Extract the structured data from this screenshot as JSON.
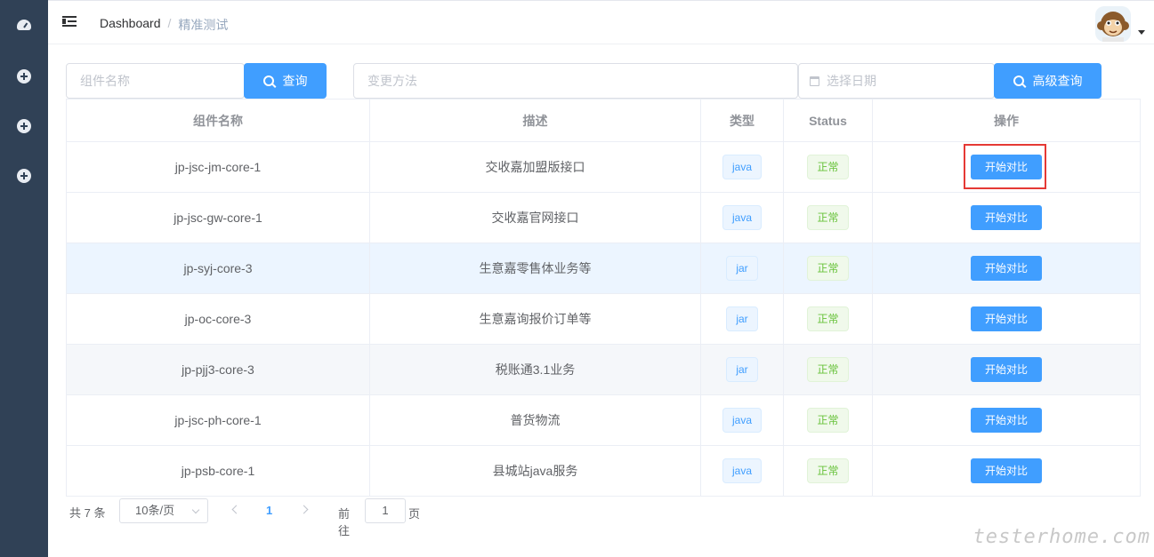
{
  "breadcrumb": {
    "home": "Dashboard",
    "separator": "/",
    "current": "精准测试"
  },
  "filters": {
    "component_placeholder": "组件名称",
    "query_label": "查询",
    "method_placeholder": "变更方法",
    "date_placeholder": "选择日期",
    "advanced_label": "高级查询"
  },
  "table": {
    "headers": [
      "组件名称",
      "描述",
      "类型",
      "Status",
      "操作"
    ],
    "rows": [
      {
        "name": "jp-jsc-jm-core-1",
        "desc": "交收嘉加盟版接口",
        "type": "java",
        "status": "正常",
        "action": "开始对比"
      },
      {
        "name": "jp-jsc-gw-core-1",
        "desc": "交收嘉官网接口",
        "type": "java",
        "status": "正常",
        "action": "开始对比"
      },
      {
        "name": "jp-syj-core-3",
        "desc": "生意嘉零售体业务等",
        "type": "jar",
        "status": "正常",
        "action": "开始对比"
      },
      {
        "name": "jp-oc-core-3",
        "desc": "生意嘉询报价订单等",
        "type": "jar",
        "status": "正常",
        "action": "开始对比"
      },
      {
        "name": "jp-pjj3-core-3",
        "desc": "税账通3.1业务",
        "type": "jar",
        "status": "正常",
        "action": "开始对比"
      },
      {
        "name": "jp-jsc-ph-core-1",
        "desc": "普货物流",
        "type": "java",
        "status": "正常",
        "action": "开始对比"
      },
      {
        "name": "jp-psb-core-1",
        "desc": "县城站java服务",
        "type": "java",
        "status": "正常",
        "action": "开始对比"
      }
    ]
  },
  "pagination": {
    "total": "共 7 条",
    "page_size": "10条/页",
    "current_page": "1",
    "goto_label": "前往",
    "goto_value": "1",
    "page_suffix": "页"
  },
  "watermark": "testerhome.com",
  "colors": {
    "sidebar": "#304156",
    "primary": "#409eff",
    "success": "#67c23a",
    "highlight": "#e53935"
  }
}
